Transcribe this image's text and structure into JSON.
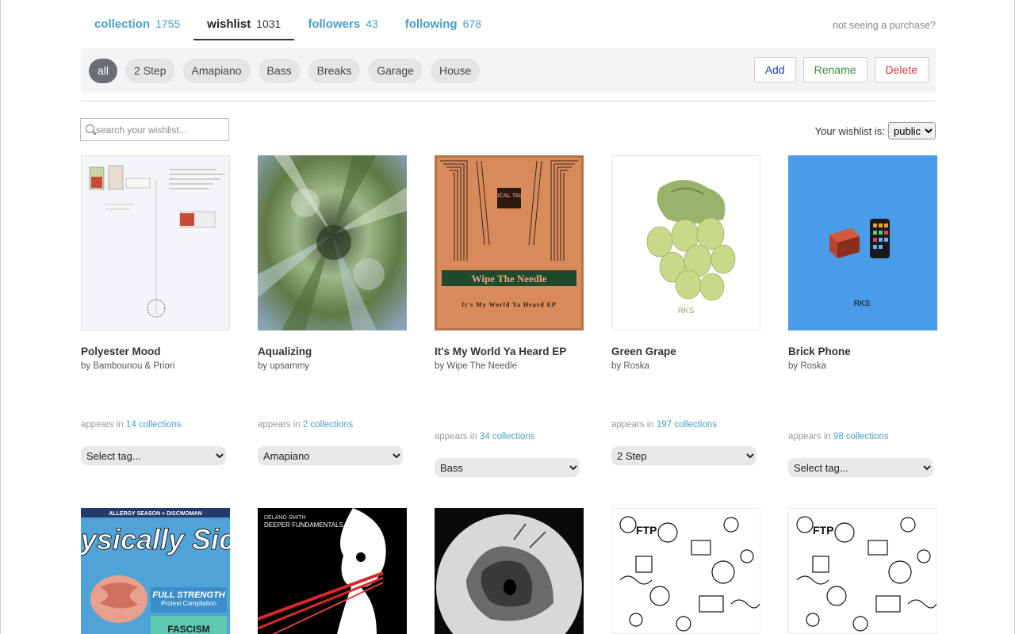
{
  "tabs": [
    {
      "label": "collection",
      "count": "1755"
    },
    {
      "label": "wishlist",
      "count": "1031"
    },
    {
      "label": "followers",
      "count": "43"
    },
    {
      "label": "following",
      "count": "678"
    }
  ],
  "not_seeing": "not seeing a purchase?",
  "tag_filters": [
    "all",
    "2 Step",
    "Amapiano",
    "Bass",
    "Breaks",
    "Garage",
    "House"
  ],
  "actions": {
    "add": "Add",
    "rename": "Rename",
    "delete": "Delete"
  },
  "search": {
    "placeholder": "search your wishlist..."
  },
  "visibility": {
    "label": "Your wishlist is:",
    "value": "public"
  },
  "appears_prefix": "appears in",
  "tag_options": [
    "Select tag...",
    "2 Step",
    "Amapiano",
    "Bass",
    "Breaks",
    "Garage",
    "House"
  ],
  "items": [
    {
      "title": "Polyester Mood",
      "artist": "by Bambounou & Priori",
      "collections": "14 collections",
      "tag": "Select tag..."
    },
    {
      "title": "Aqualizing",
      "artist": "by upsammy",
      "collections": "2 collections",
      "tag": "Amapiano"
    },
    {
      "title": "It's My World Ya Heard EP",
      "artist": "by Wipe The Needle",
      "collections": "34 collections",
      "tag": "Bass",
      "cover_text": "Wipe The Needle",
      "cover_subtext": "It's My World Ya Heard EP",
      "cover_logo": "LOCAL TALK"
    },
    {
      "title": "Green Grape",
      "artist": "by Roska",
      "collections": "197 collections",
      "tag": "2 Step",
      "cover_logo": "RKS"
    },
    {
      "title": "Brick Phone",
      "artist": "by Roska",
      "collections": "98 collections",
      "tag": "Select tag...",
      "cover_logo": "RKS"
    }
  ],
  "row2": [
    {
      "cover_top": "ALLERGY SEASON + DISCWOMAN",
      "cover_main": "Physically Sick",
      "cover_sub": "FULL STRENGTH",
      "cover_sub2": "Protest Compilation",
      "cover_bottom": "FASCISM"
    },
    {
      "cover_artist": "DELANO SMITH",
      "cover_title": "DEEPER FUNDAMENTALS I"
    },
    {},
    {
      "cover_logo": "FTP"
    },
    {
      "cover_logo": "FTP"
    }
  ],
  "colors": {
    "link": "#4a9dc4",
    "add": "#1f3fa8",
    "rename": "#3b8a3b",
    "delete": "#d23a3a",
    "brick_bg": "#4a9be8",
    "wtn_bg": "#d98a5c"
  }
}
